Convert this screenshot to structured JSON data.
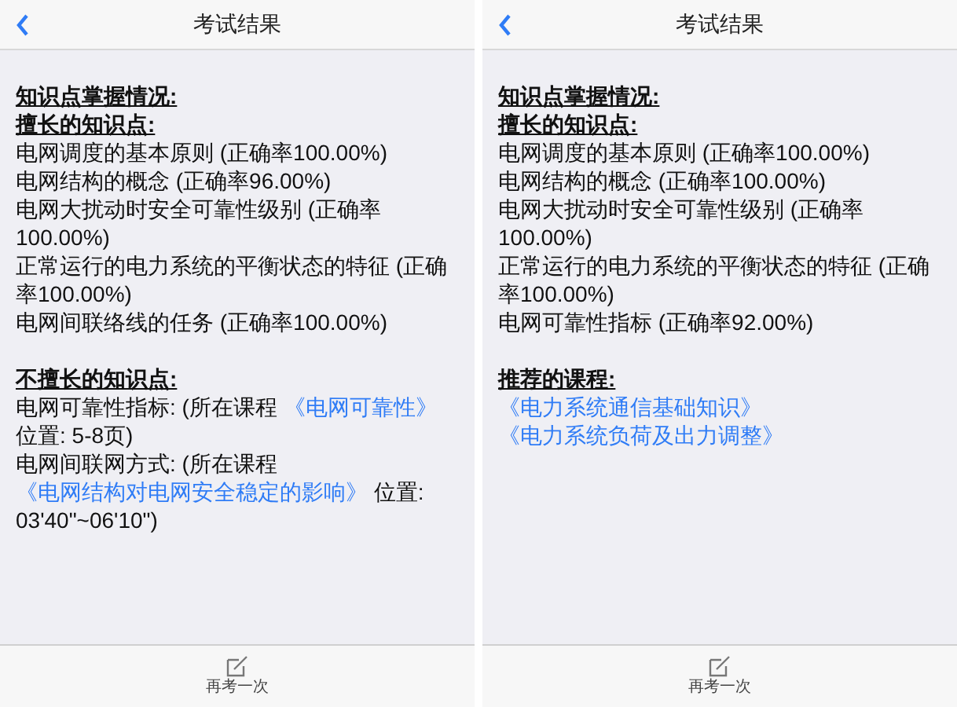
{
  "screens": [
    {
      "title": "考试结果",
      "sections": [
        {
          "heading": "知识点掌握情况:"
        },
        {
          "heading": "擅长的知识点:",
          "lines": [
            {
              "text": "电网调度的基本原则 (正确率100.00%)"
            },
            {
              "text": "电网结构的概念 (正确率96.00%)"
            },
            {
              "text": "电网大扰动时安全可靠性级别 (正确率100.00%)"
            },
            {
              "text": "正常运行的电力系统的平衡状态的特征 (正确率100.00%)"
            },
            {
              "text": "电网间联络线的任务 (正确率100.00%)"
            }
          ]
        },
        {
          "heading": "不擅长的知识点:",
          "lines": [
            {
              "text": "电网可靠性指标: (所在课程",
              "course": "《电网可靠性》",
              "tail": "位置: 5-8页)"
            },
            {
              "text": "电网间联网方式: (所在课程",
              "course": "《电网结构对电网安全稳定的影响》",
              "tail": "位置: 03'40\"~06'10\")"
            }
          ]
        }
      ],
      "footer_button": "再考一次"
    },
    {
      "title": "考试结果",
      "sections": [
        {
          "heading": "知识点掌握情况:"
        },
        {
          "heading": "擅长的知识点:",
          "lines": [
            {
              "text": "电网调度的基本原则 (正确率100.00%)"
            },
            {
              "text": "电网结构的概念 (正确率100.00%)"
            },
            {
              "text": "电网大扰动时安全可靠性级别 (正确率100.00%)"
            },
            {
              "text": "正常运行的电力系统的平衡状态的特征 (正确率100.00%)"
            },
            {
              "text": "电网可靠性指标 (正确率92.00%)"
            }
          ]
        },
        {
          "heading": "推荐的课程:",
          "lines": [
            {
              "course": "《电力系统通信基础知识》"
            },
            {
              "course": "《电力系统负荷及出力调整》"
            }
          ]
        }
      ],
      "footer_button": "再考一次"
    }
  ]
}
